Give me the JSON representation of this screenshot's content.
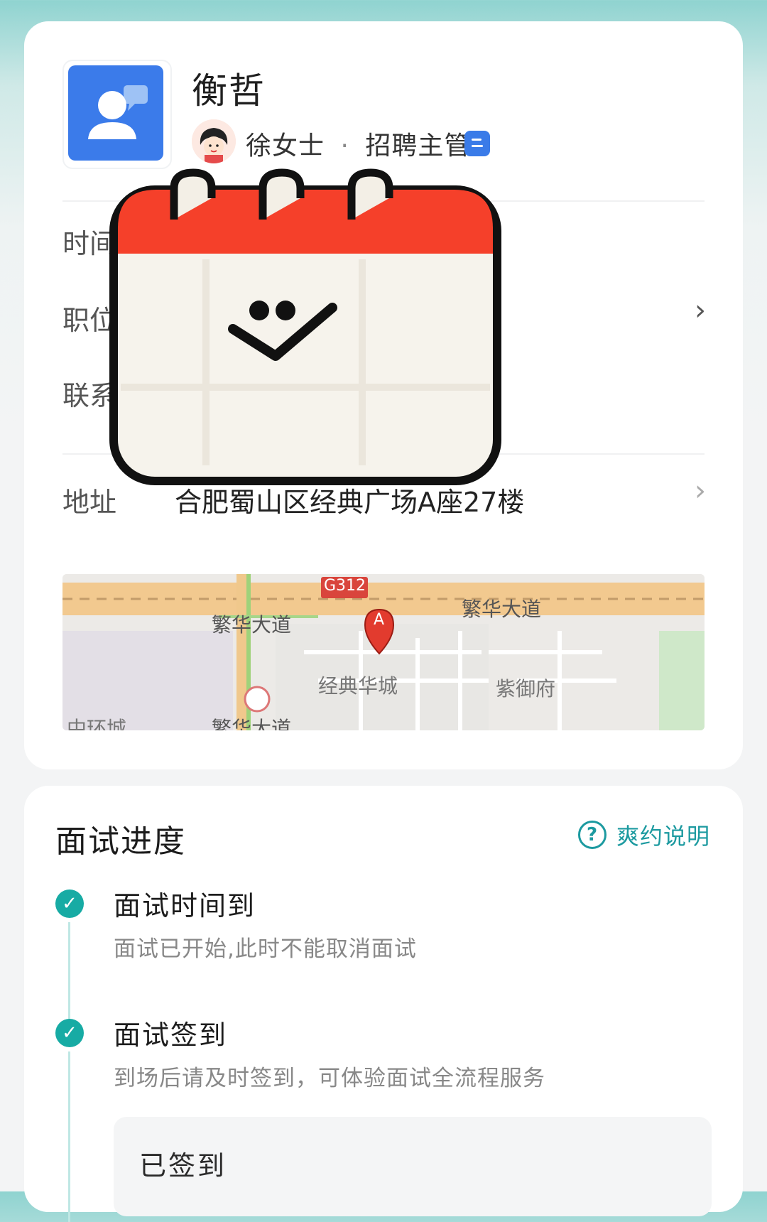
{
  "company": {
    "name": "衡哲",
    "hr_name": "徐女士",
    "hr_sep": "·",
    "hr_title": "招聘主管"
  },
  "rows": {
    "time_label": "时间",
    "position_label": "职位",
    "contact_label": "联系",
    "address_label": "地址",
    "address_value": "合肥蜀山区经典广场A座27楼"
  },
  "map": {
    "road_badge": "G312",
    "road_1": "繁华大道",
    "road_2": "繁华大道",
    "road_3": "繁华大道",
    "place_1": "经典华城",
    "place_2": "紫御府",
    "place_3": "中环城",
    "marker_letter": "A"
  },
  "progress": {
    "title": "面试进度",
    "help_label": "爽约说明",
    "steps": [
      {
        "title": "面试时间到",
        "desc": "面试已开始,此时不能取消面试"
      },
      {
        "title": "面试签到",
        "desc": "到场后请及时签到，可体验面试全流程服务"
      }
    ],
    "signed_label": "已签到"
  },
  "colors": {
    "accent": "#17aba4",
    "logo_blue": "#3b7bea",
    "calendar_red": "#f5402a"
  }
}
